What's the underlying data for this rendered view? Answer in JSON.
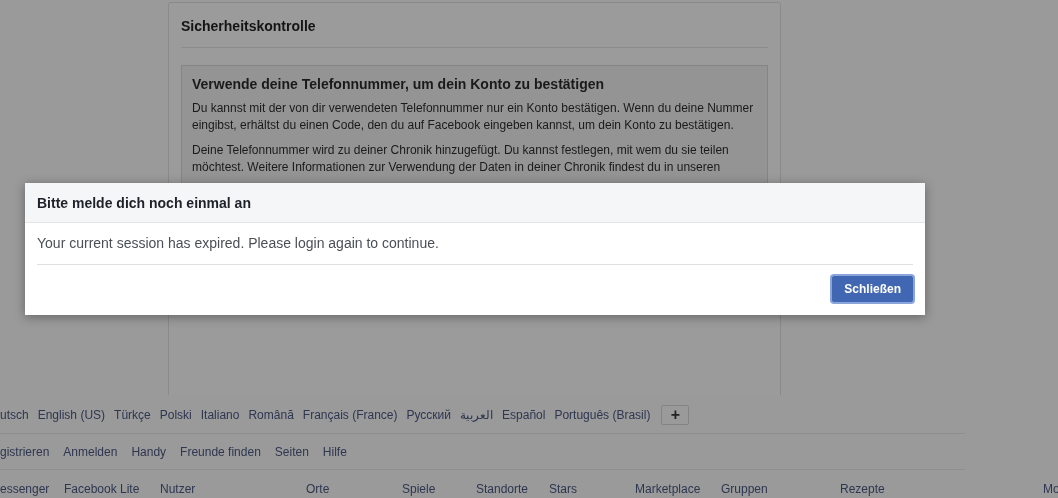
{
  "page": {
    "card": {
      "title": "Sicherheitskontrolle",
      "section": {
        "heading": "Verwende deine Telefonnummer, um dein Konto zu bestätigen",
        "paragraphs": [
          "Du kannst mit der von dir verwendeten Telefonnummer nur ein Konto bestätigen. Wenn du deine Nummer eingibst, erhältst du einen Code, den du auf Facebook eingeben kannst, um dein Konto zu bestätigen.",
          "Deine Telefonnummer wird zu deiner Chronik hinzugefügt. Du kannst festlegen, mit wem du sie teilen möchtest. Weitere Informationen zur Verwendung der Daten in deiner Chronik findest du in unseren"
        ]
      }
    }
  },
  "dialog": {
    "title": "Bitte melde dich noch einmal an",
    "message": "Your current session has expired. Please login again to continue.",
    "buttons": [
      {
        "label": "Schließen",
        "kind": "primary"
      }
    ]
  },
  "footer": {
    "languages": [
      "utsch",
      "English (US)",
      "Türkçe",
      "Polski",
      "Italiano",
      "Română",
      "Français (France)",
      "Русский",
      "العربية",
      "Español",
      "Português (Brasil)"
    ],
    "more_languages": "+",
    "links": [
      "gistrieren",
      "Anmelden",
      "Handy",
      "Freunde finden",
      "Seiten",
      "Hilfe"
    ],
    "directory": [
      "essenger",
      "Facebook Lite",
      "Nutzer",
      "Orte",
      "Spiele",
      "Standorte",
      "Stars",
      "Marketplace",
      "Gruppen",
      "Rezepte",
      "Mo"
    ]
  }
}
